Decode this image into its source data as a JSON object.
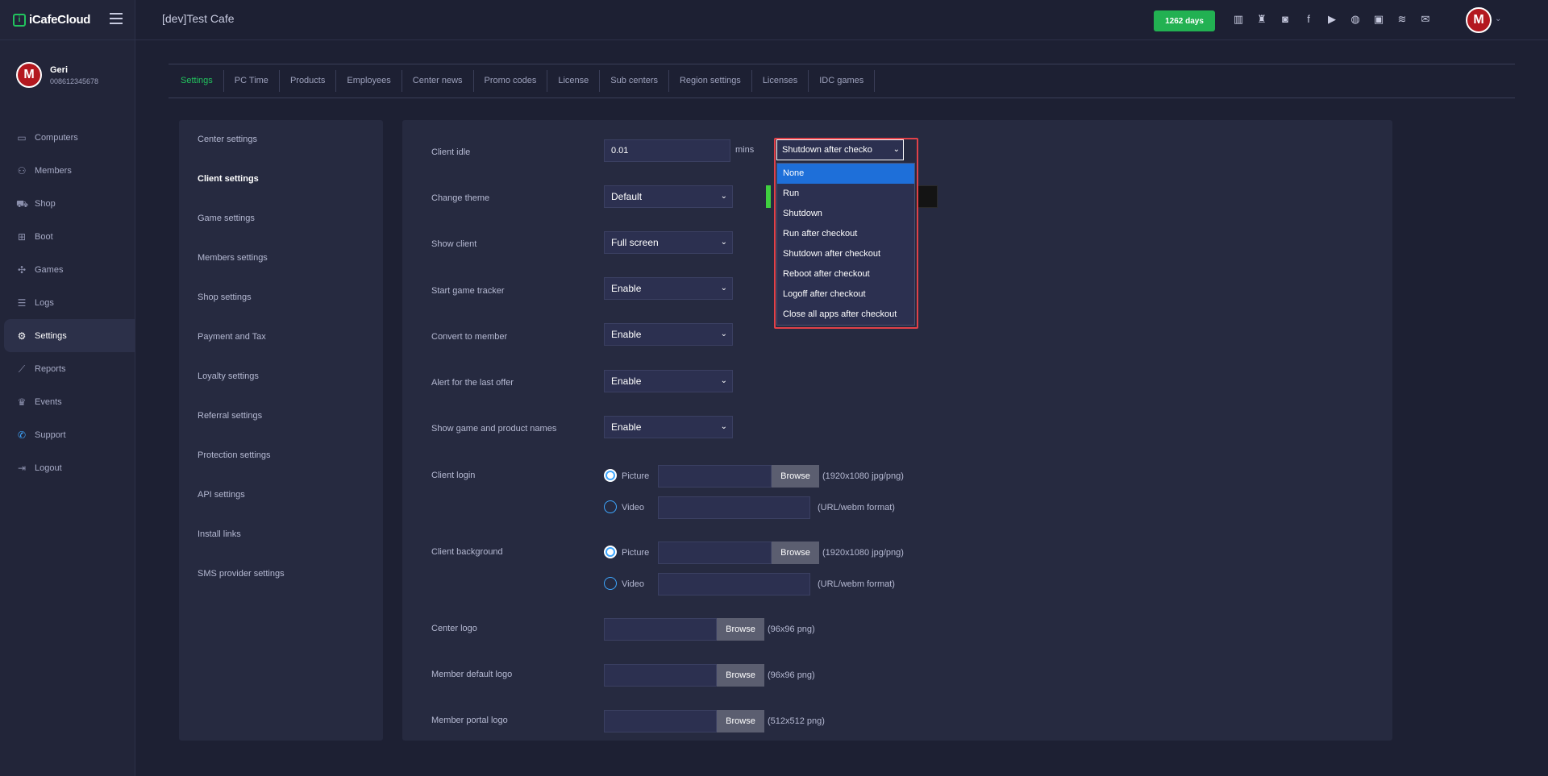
{
  "brand": {
    "name": "iCafeCloud"
  },
  "user": {
    "name": "Geri",
    "phone": "008612345678",
    "initial": "M"
  },
  "sidebar": {
    "items": [
      {
        "label": "Computers",
        "icon": "monitor-icon",
        "glyph": "▭"
      },
      {
        "label": "Members",
        "icon": "members-icon",
        "glyph": "⚇"
      },
      {
        "label": "Shop",
        "icon": "cart-icon",
        "glyph": "⛟"
      },
      {
        "label": "Boot",
        "icon": "windows-icon",
        "glyph": "⊞"
      },
      {
        "label": "Games",
        "icon": "gamepad-icon",
        "glyph": "✣"
      },
      {
        "label": "Logs",
        "icon": "list-icon",
        "glyph": "☰"
      },
      {
        "label": "Settings",
        "icon": "gear-icon",
        "glyph": "⚙"
      },
      {
        "label": "Reports",
        "icon": "chart-icon",
        "glyph": "⟋"
      },
      {
        "label": "Events",
        "icon": "crown-icon",
        "glyph": "♛"
      },
      {
        "label": "Support",
        "icon": "phone-icon",
        "glyph": "✆"
      },
      {
        "label": "Logout",
        "icon": "logout-icon",
        "glyph": "⇥"
      }
    ]
  },
  "header": {
    "cafe_title": "[dev]Test Cafe",
    "days_badge": "1262 days"
  },
  "tabs": [
    "Settings",
    "PC Time",
    "Products",
    "Employees",
    "Center news",
    "Promo codes",
    "License",
    "Sub centers",
    "Region settings",
    "Licenses",
    "IDC games"
  ],
  "settings_menu": [
    "Center settings",
    "Client settings",
    "Game settings",
    "Members settings",
    "Shop settings",
    "Payment and Tax",
    "Loyalty settings",
    "Referral settings",
    "Protection settings",
    "API settings",
    "Install links",
    "SMS provider settings"
  ],
  "form": {
    "client_idle": {
      "label": "Client idle",
      "value": "0.01",
      "suffix": "mins"
    },
    "change_theme": {
      "label": "Change theme",
      "value": "Default"
    },
    "show_client": {
      "label": "Show client",
      "value": "Full screen"
    },
    "start_game_tracker": {
      "label": "Start game tracker",
      "value": "Enable"
    },
    "convert_to_member": {
      "label": "Convert to member",
      "value": "Enable"
    },
    "alert_last_offer": {
      "label": "Alert for the last offer",
      "value": "Enable"
    },
    "show_names": {
      "label": "Show game and product names",
      "value": "Enable"
    },
    "client_login": {
      "label": "Client login",
      "picture": "Picture",
      "video": "Video",
      "browse": "Browse",
      "picture_hint": "(1920x1080 jpg/png)",
      "video_hint": "(URL/webm format)"
    },
    "client_background": {
      "label": "Client background",
      "picture": "Picture",
      "video": "Video",
      "browse": "Browse",
      "picture_hint": "(1920x1080 jpg/png)",
      "video_hint": "(URL/webm format)"
    },
    "center_logo": {
      "label": "Center logo",
      "browse": "Browse",
      "hint": "(96x96 png)"
    },
    "member_default_logo": {
      "label": "Member default logo",
      "browse": "Browse",
      "hint": "(96x96 png)"
    },
    "member_portal_logo": {
      "label": "Member portal logo",
      "browse": "Browse",
      "hint": "(512x512 png)"
    }
  },
  "idle_action": {
    "selected": "Shutdown after checko",
    "options": [
      "None",
      "Run",
      "Shutdown",
      "Run after checkout",
      "Shutdown after checkout",
      "Reboot after checkout",
      "Logoff after checkout",
      "Close all apps after checkout"
    ]
  },
  "colors": {
    "accent": "#22c35e",
    "badge": "#22b152",
    "highlight": "#1e6fd9",
    "frame": "#e14149"
  }
}
